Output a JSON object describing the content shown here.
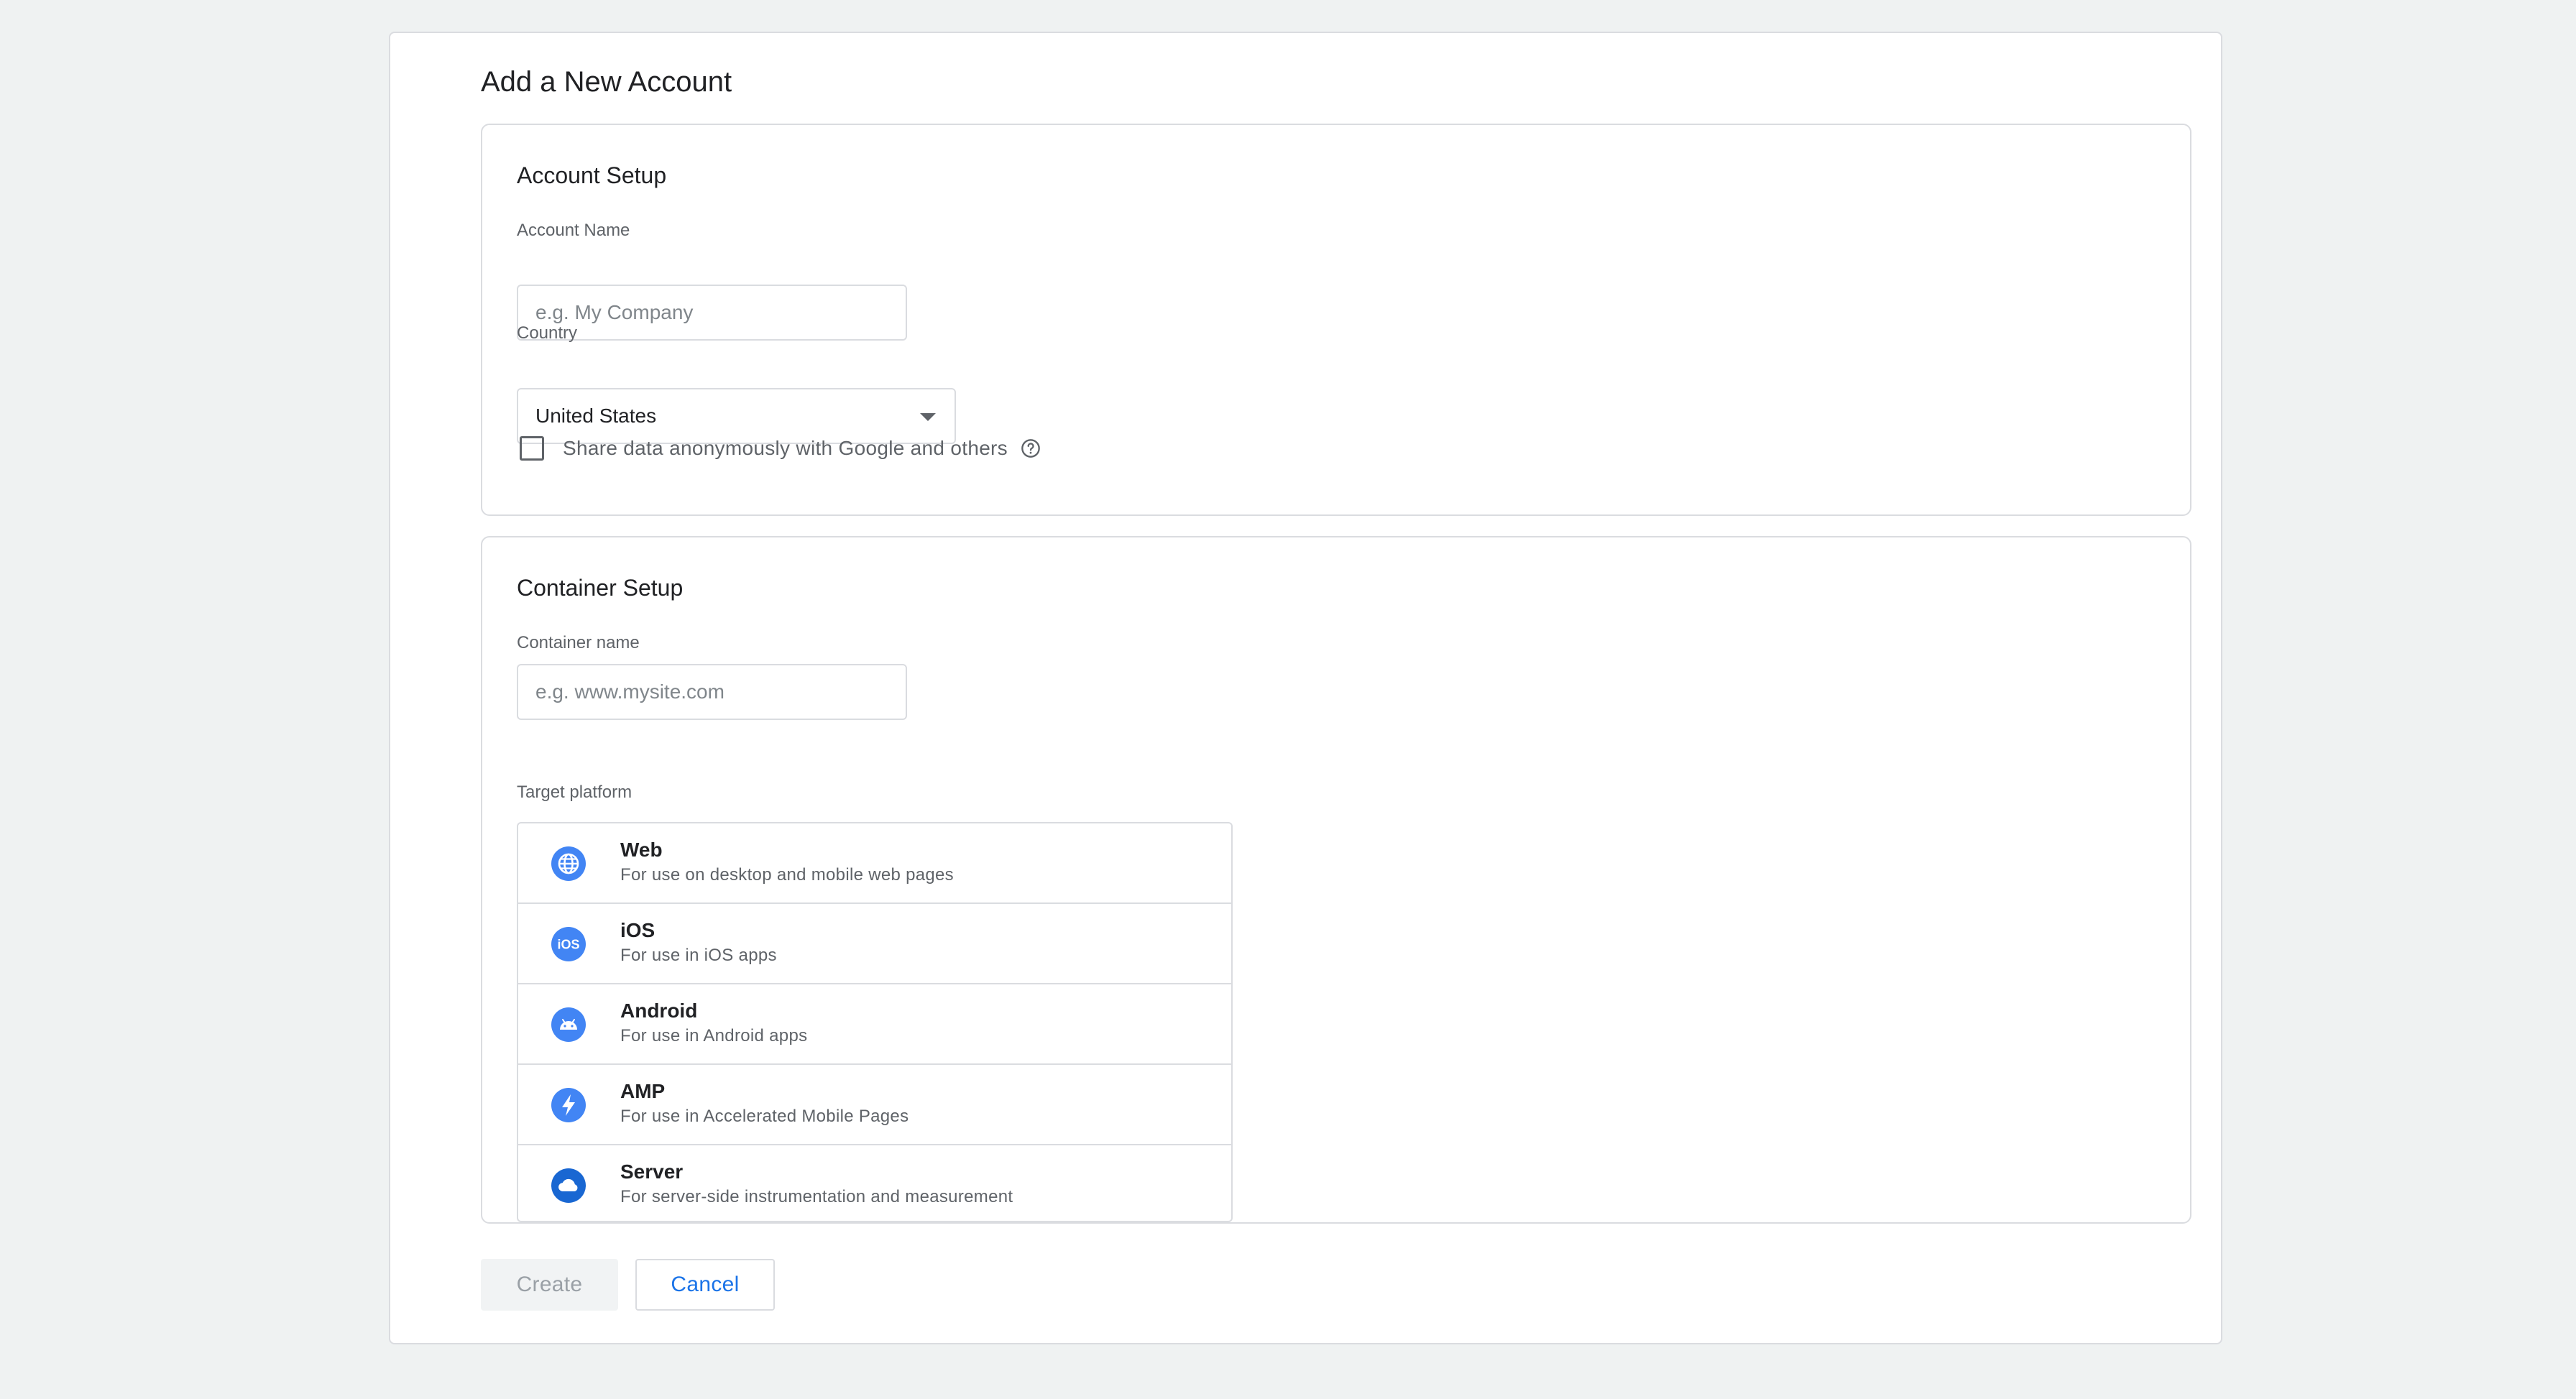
{
  "page": {
    "title": "Add a New Account"
  },
  "account_setup": {
    "title": "Account Setup",
    "account_name_label": "Account Name",
    "account_name_placeholder": "e.g. My Company",
    "account_name_value": "",
    "country_label": "Country",
    "country_value": "United States",
    "share_data_label": "Share data anonymously with Google and others",
    "share_data_checked": false
  },
  "container_setup": {
    "title": "Container Setup",
    "container_name_label": "Container name",
    "container_name_placeholder": "e.g. www.mysite.com",
    "container_name_value": "",
    "target_platform_label": "Target platform",
    "platforms": [
      {
        "name": "Web",
        "description": "For use on desktop and mobile web pages",
        "icon": "globe-icon"
      },
      {
        "name": "iOS",
        "description": "For use in iOS apps",
        "icon": "ios-icon"
      },
      {
        "name": "Android",
        "description": "For use in Android apps",
        "icon": "android-icon"
      },
      {
        "name": "AMP",
        "description": "For use in Accelerated Mobile Pages",
        "icon": "amp-bolt-icon"
      },
      {
        "name": "Server",
        "description": "For server-side instrumentation and measurement",
        "icon": "cloud-icon"
      }
    ]
  },
  "actions": {
    "create_label": "Create",
    "cancel_label": "Cancel"
  },
  "colors": {
    "accent": "#1a73e8",
    "icon_blue": "#4285f4",
    "border": "#dadce0",
    "background": "#eff2f2"
  }
}
